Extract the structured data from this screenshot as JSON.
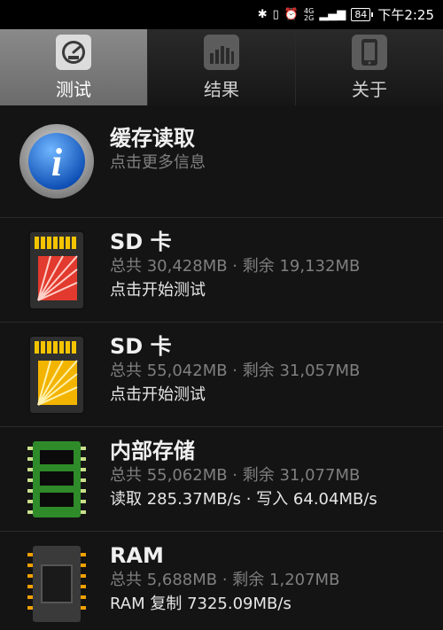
{
  "statusbar": {
    "network_top": "4G",
    "network_bottom": "2G",
    "battery": "84",
    "time": "下午2:25"
  },
  "tabs": [
    {
      "label": "测试",
      "icon": "speedometer-icon",
      "active": true
    },
    {
      "label": "结果",
      "icon": "bar-chart-icon",
      "active": false
    },
    {
      "label": "关于",
      "icon": "phone-icon",
      "active": false
    }
  ],
  "list": {
    "info": {
      "title": "缓存读取",
      "subtitle": "点击更多信息",
      "icon": "info-icon"
    },
    "sd1": {
      "title": "SD 卡",
      "subtitle": "总共 30,428MB · 剩余 19,132MB",
      "action": "点击开始测试",
      "color": "#e23a2e"
    },
    "sd2": {
      "title": "SD 卡",
      "subtitle": "总共 55,042MB · 剩余 31,057MB",
      "action": "点击开始测试",
      "color": "#f3b400"
    },
    "internal": {
      "title": "内部存储",
      "subtitle": "总共 55,062MB · 剩余 31,077MB",
      "action": "读取 285.37MB/s · 写入 64.04MB/s"
    },
    "ram": {
      "title": "RAM",
      "subtitle": "总共 5,688MB · 剩余 1,207MB",
      "action": "RAM 复制 7325.09MB/s"
    }
  }
}
